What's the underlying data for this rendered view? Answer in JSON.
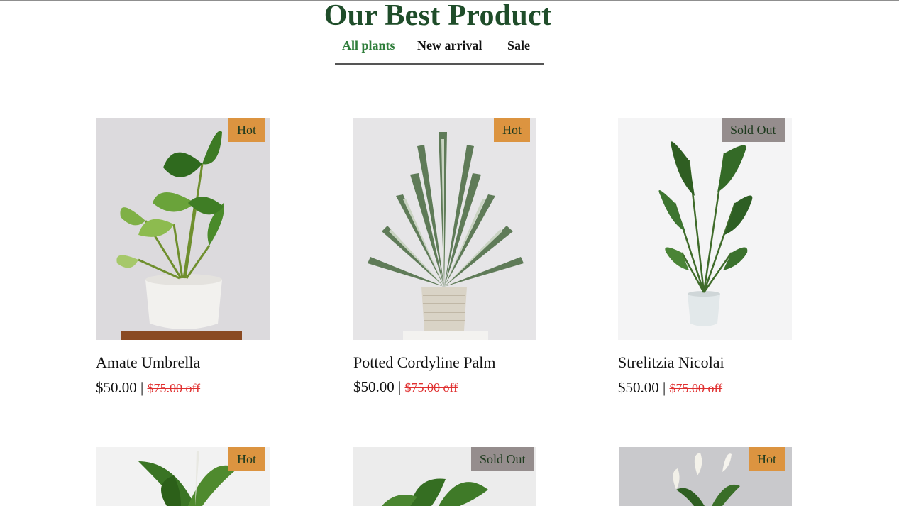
{
  "section": {
    "title": "Our Best Product"
  },
  "tabs": [
    {
      "label": "All plants",
      "active": true
    },
    {
      "label": "New arrival",
      "active": false
    },
    {
      "label": "Sale",
      "active": false
    }
  ],
  "colors": {
    "title_green": "#1f4d2a",
    "active_tab": "#2e7d3a",
    "badge_hot": "#dc9440",
    "badge_sold_out": "#958d8d",
    "old_price": "#e03030"
  },
  "products": [
    {
      "name": "Amate Umbrella",
      "price": "$50.00",
      "separator": "|",
      "old_price": "$75.00 off",
      "badge": "Hot"
    },
    {
      "name": "Potted Cordyline Palm",
      "price": "$50.00",
      "separator": "|",
      "old_price": "$75.00 off",
      "badge": "Hot"
    },
    {
      "name": "Strelitzia Nicolai",
      "price": "$50.00",
      "separator": "|",
      "old_price": "$75.00 off",
      "badge": "Sold Out"
    },
    {
      "badge": "Hot"
    },
    {
      "badge": "Sold Out"
    },
    {
      "badge": "Hot"
    }
  ]
}
